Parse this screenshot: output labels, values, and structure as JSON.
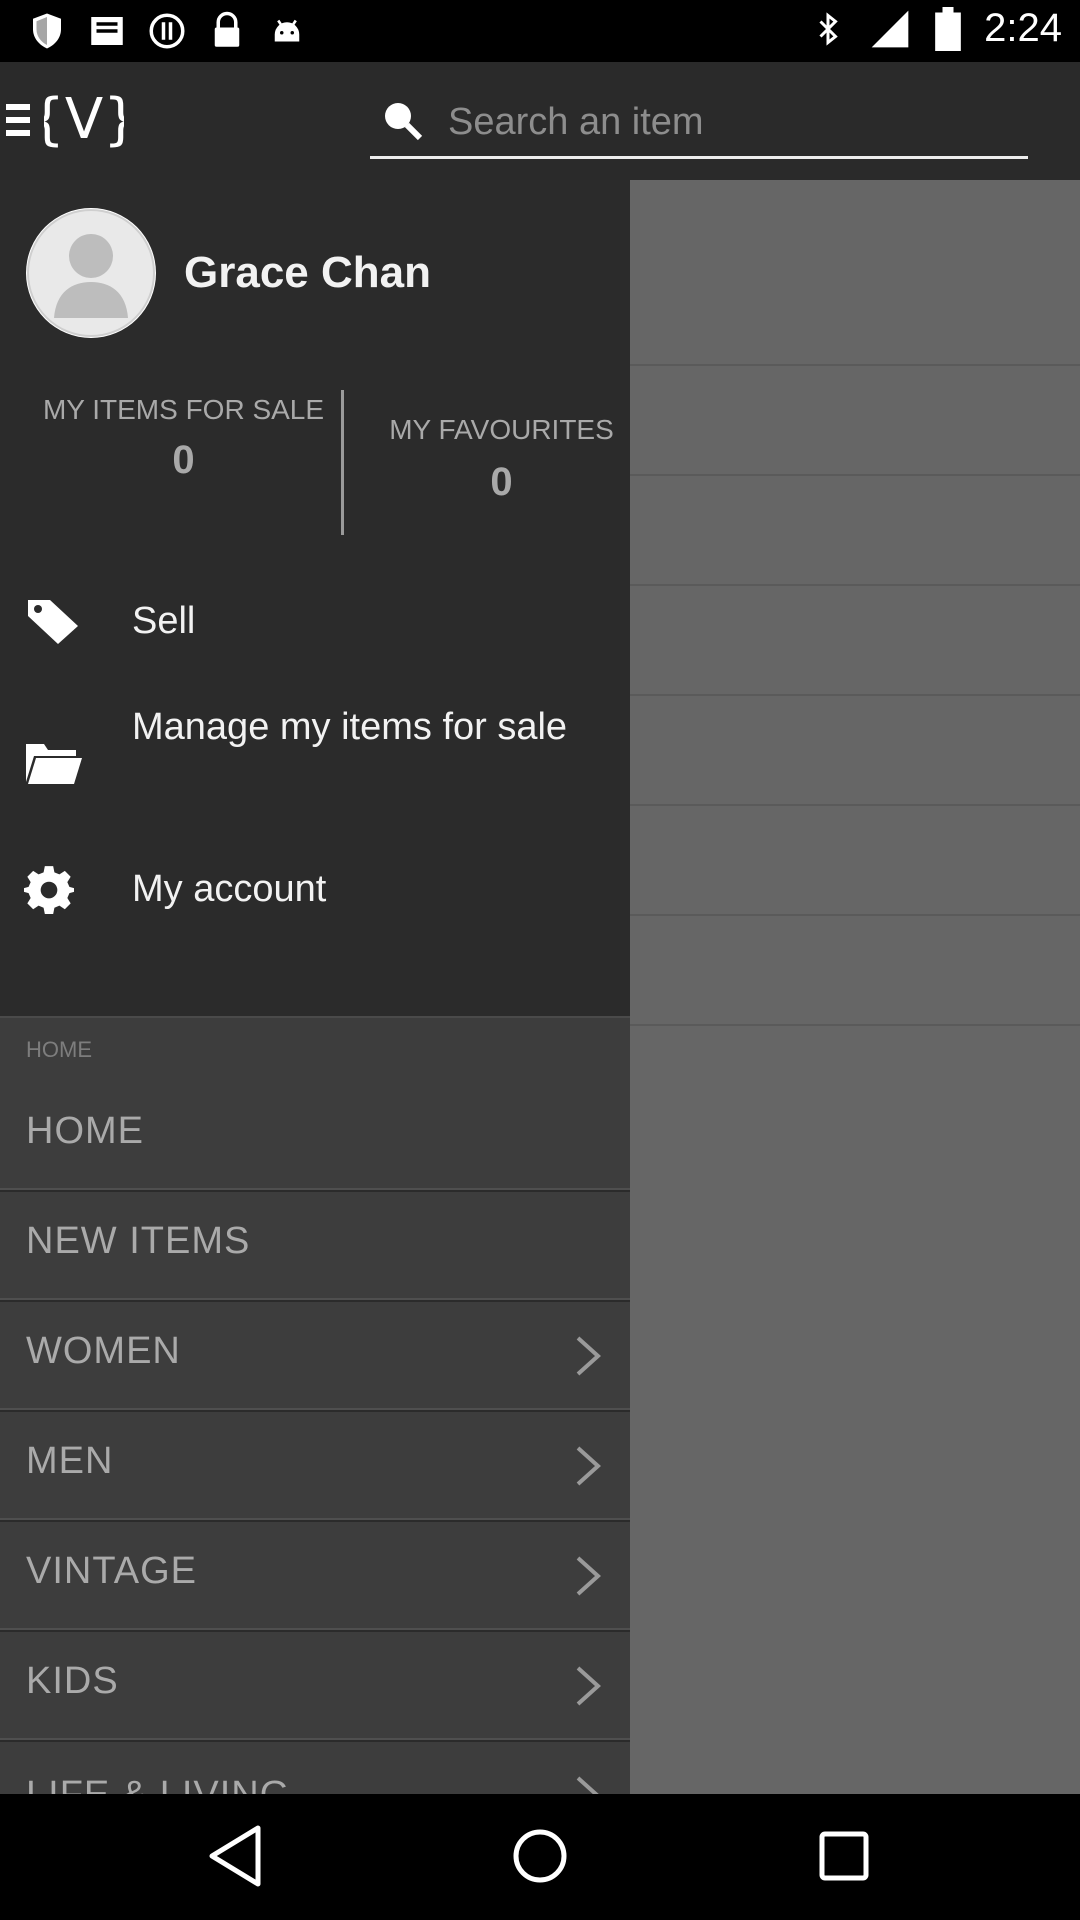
{
  "status_bar": {
    "time": "2:24",
    "left_icons": [
      "shield-icon",
      "inbox-icon",
      "settings-circle-icon",
      "lock-icon",
      "android-icon"
    ],
    "right_icons": [
      "bluetooth-icon",
      "signal-icon",
      "battery-icon"
    ]
  },
  "app_bar": {
    "menu_icon": "hamburger-icon",
    "logo_text": "{V}",
    "search": {
      "placeholder": "Search an item",
      "value": ""
    }
  },
  "drawer": {
    "user": {
      "name": "Grace Chan",
      "avatar_icon": "person-icon"
    },
    "stats": [
      {
        "label": "MY ITEMS FOR SALE",
        "value": "0"
      },
      {
        "label": "MY FAVOURITES",
        "value": "0"
      }
    ],
    "actions": [
      {
        "label": "Sell",
        "icon": "tag-icon"
      },
      {
        "label": "Manage my items for sale",
        "icon": "folder-icon"
      },
      {
        "label": "My account",
        "icon": "gear-icon"
      }
    ],
    "section_header": "HOME",
    "categories": [
      {
        "label": "HOME",
        "has_submenu": false
      },
      {
        "label": "NEW ITEMS",
        "has_submenu": false
      },
      {
        "label": "WOMEN",
        "has_submenu": true
      },
      {
        "label": "MEN",
        "has_submenu": true
      },
      {
        "label": "VINTAGE",
        "has_submenu": true
      },
      {
        "label": "KIDS",
        "has_submenu": true
      },
      {
        "label": "LIFE & LIVING",
        "has_submenu": true
      }
    ]
  },
  "nav_bar": {
    "buttons": [
      "back-icon",
      "home-icon",
      "recents-icon"
    ]
  },
  "colors": {
    "app_bar_bg": "#2a2a2a",
    "drawer_bg": "#2b2b2b",
    "category_bg": "#3d3d3d",
    "dim_bg": "#666666"
  }
}
